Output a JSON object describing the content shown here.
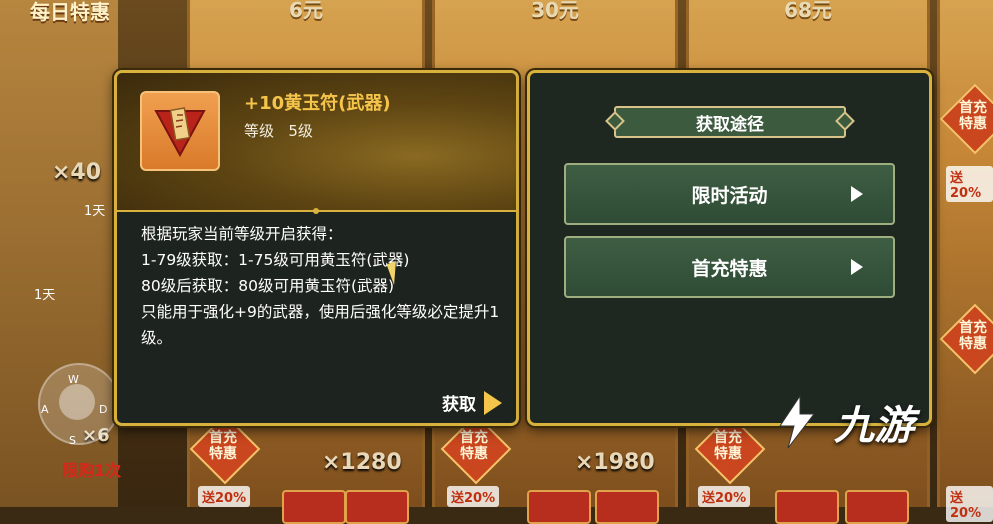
{
  "background": {
    "daily_title": "每日特惠",
    "top_prices": [
      "6元",
      "30元",
      "68元"
    ],
    "bonus_labels": [
      "送20%",
      "送20%",
      "送20%",
      "送20%",
      "送20%"
    ],
    "badges": [
      "首充\n特惠",
      "首充\n特惠",
      "首充\n特惠",
      "首充\n特惠",
      "首充\n特惠"
    ],
    "quantities": [
      "×40",
      "×1280",
      "×1980",
      "×6"
    ],
    "days": [
      "1天",
      "1天"
    ],
    "limit_text": "限购1次",
    "joystick_keys": {
      "w": "W",
      "a": "A",
      "s": "S",
      "d": "D"
    },
    "logo_text": "九游"
  },
  "item_panel": {
    "name": "+10黄玉符(武器)",
    "level_label": "等级",
    "level_value": "5级",
    "description": "根据玩家当前等级开启获得：\n1-79级获取：1-75级可用黄玉符(武器)\n80级后获取：80级可用黄玉符(武器)\n只能用于强化+9的武器，使用后强化等级必定提升1级。",
    "obtain_label": "获取"
  },
  "source_panel": {
    "title": "获取途径",
    "sources": [
      {
        "label": "限时活动"
      },
      {
        "label": "首充特惠"
      }
    ]
  },
  "colors": {
    "panel_border": "#d9b23e",
    "item_name": "#f5c54b",
    "button_green": "#3e5e43"
  }
}
